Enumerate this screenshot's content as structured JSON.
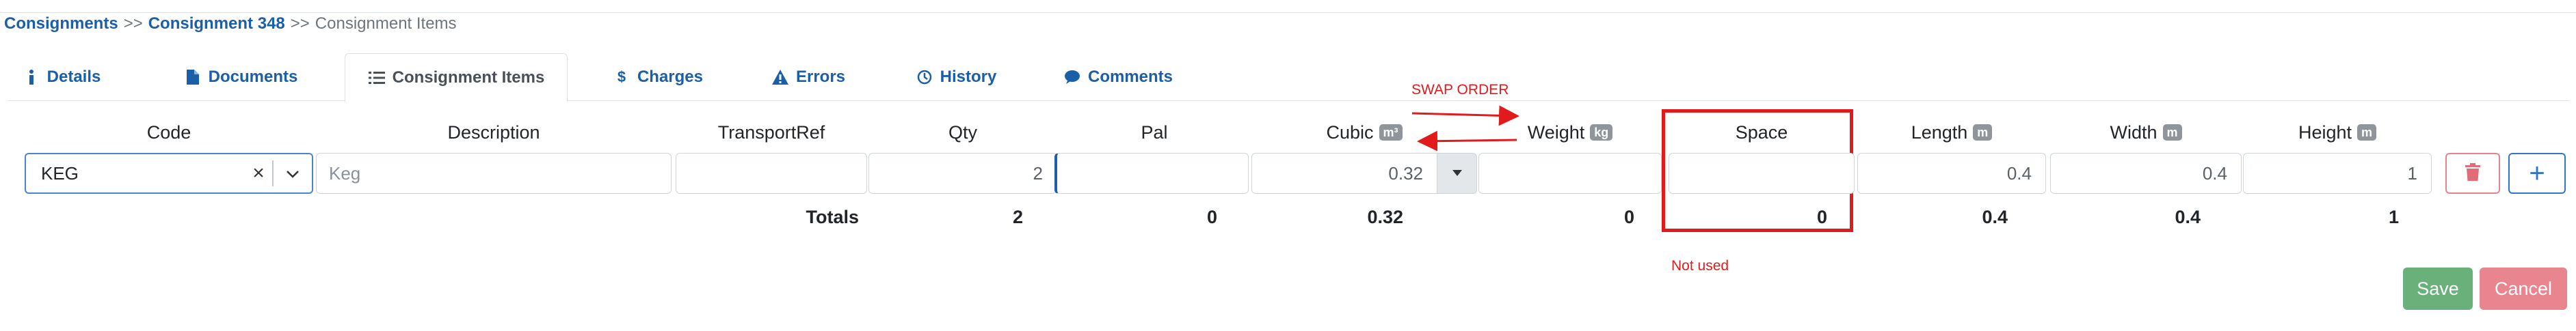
{
  "breadcrumb": {
    "items": [
      "Consignments",
      "Consignment 348"
    ],
    "separator": ">>",
    "current": "Consignment Items"
  },
  "tabs": [
    {
      "label": "Details",
      "icon": "info-icon"
    },
    {
      "label": "Documents",
      "icon": "file-icon"
    },
    {
      "label": "Consignment Items",
      "icon": "list-icon",
      "active": true
    },
    {
      "label": "Charges",
      "icon": "dollar-icon"
    },
    {
      "label": "Errors",
      "icon": "warning-icon"
    },
    {
      "label": "History",
      "icon": "clock-icon"
    },
    {
      "label": "Comments",
      "icon": "comment-icon"
    }
  ],
  "annotations": {
    "swap_order": "SWAP ORDER",
    "not_used": "Not used",
    "color": "#e11b1b"
  },
  "columns": {
    "code": "Code",
    "description": "Description",
    "transport_ref": "TransportRef",
    "qty": "Qty",
    "pal": "Pal",
    "cubic": "Cubic",
    "cubic_unit": "m³",
    "weight": "Weight",
    "weight_unit": "kg",
    "space": "Space",
    "length": "Length",
    "length_unit": "m",
    "width": "Width",
    "width_unit": "m",
    "height": "Height",
    "height_unit": "m"
  },
  "row": {
    "code": "KEG",
    "description_placeholder": "Keg",
    "transport_ref": "",
    "qty": "2",
    "pal": "",
    "cubic": "0.32",
    "weight": "",
    "space": "",
    "length": "0.4",
    "width": "0.4",
    "height": "1"
  },
  "totals": {
    "label": "Totals",
    "qty": "2",
    "pal": "0",
    "cubic": "0.32",
    "weight": "0",
    "space": "0",
    "length": "0.4",
    "width": "0.4",
    "height": "1"
  },
  "buttons": {
    "save": "Save",
    "cancel": "Cancel",
    "delete_icon": "trash-icon",
    "add_icon": "plus-icon"
  },
  "colors": {
    "link": "#1a5fa8",
    "save": "#6ab07a",
    "cancel": "#e9858f",
    "delete": "#e16b76",
    "add": "#2f76c9"
  }
}
